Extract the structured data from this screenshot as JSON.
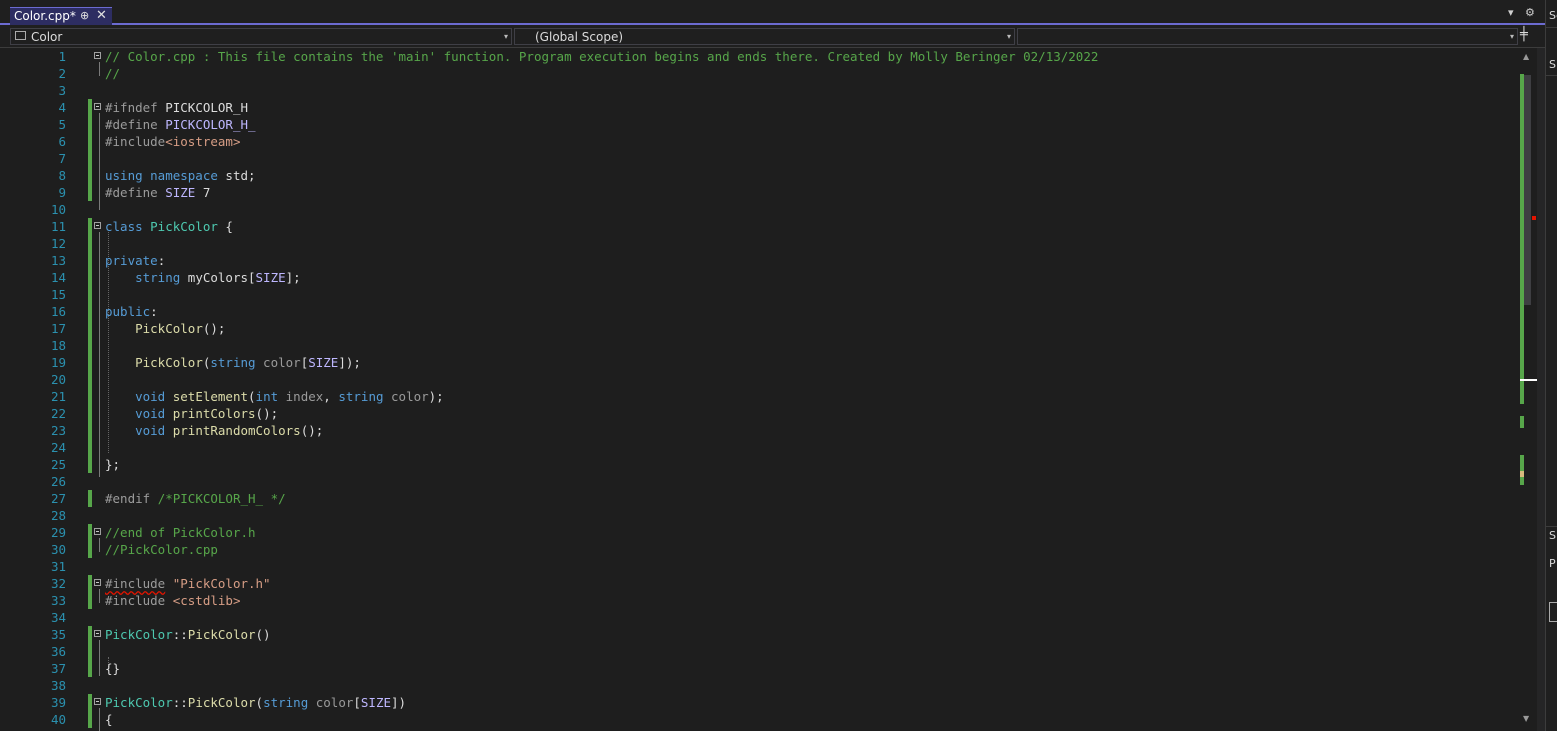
{
  "tab": {
    "title": "Color.cpp*",
    "pin_glyph": "⊕",
    "close_glyph": "✕"
  },
  "tabstrip_tools": {
    "dropdown_glyph": "▾",
    "gear_glyph": "⚙"
  },
  "navbar": {
    "project": "Color",
    "scope": "(Global Scope)",
    "member": "",
    "arrow": "▾",
    "split_glyph": "╪"
  },
  "right_panel": {
    "labels": [
      "Se",
      "S",
      "S",
      "P"
    ]
  },
  "colors": {
    "accent": "#6c6bd1",
    "comment": "#57a64a",
    "keyword": "#569cd6",
    "class": "#4ec9b0",
    "function": "#dcdcaa",
    "string": "#d69d85",
    "macro": "#beb7ff",
    "line_number": "#2b91af",
    "change_bar": "#57a64a"
  },
  "editor": {
    "lines": [
      {
        "n": "1",
        "fold": true,
        "chg": false,
        "t": [
          [
            "com",
            "// Color.cpp : This file contains the 'main' function. Program execution begins and ends there. Created by Molly Beringer 02/13/2022"
          ]
        ]
      },
      {
        "n": "2",
        "fold": false,
        "chg": false,
        "t": [
          [
            "com",
            "//"
          ]
        ]
      },
      {
        "n": "3",
        "fold": false,
        "chg": false,
        "t": []
      },
      {
        "n": "4",
        "fold": true,
        "chg": true,
        "t": [
          [
            "pre",
            "#ifndef "
          ],
          [
            "id",
            "PICKCOLOR_H"
          ]
        ]
      },
      {
        "n": "5",
        "fold": false,
        "chg": true,
        "t": [
          [
            "pre",
            "#define "
          ],
          [
            "mac",
            "PICKCOLOR_H_"
          ]
        ]
      },
      {
        "n": "6",
        "fold": false,
        "chg": true,
        "t": [
          [
            "pre",
            "#include"
          ],
          [
            "str",
            "<iostream>"
          ]
        ]
      },
      {
        "n": "7",
        "fold": false,
        "chg": true,
        "t": []
      },
      {
        "n": "8",
        "fold": false,
        "chg": true,
        "t": [
          [
            "kw",
            "using namespace "
          ],
          [
            "id",
            "std;"
          ]
        ]
      },
      {
        "n": "9",
        "fold": false,
        "chg": true,
        "t": [
          [
            "pre",
            "#define "
          ],
          [
            "mac",
            "SIZE"
          ],
          [
            "id",
            " 7"
          ]
        ]
      },
      {
        "n": "10",
        "fold": false,
        "chg": false,
        "t": []
      },
      {
        "n": "11",
        "fold": true,
        "chg": true,
        "t": [
          [
            "kw",
            "class "
          ],
          [
            "cls",
            "PickColor"
          ],
          [
            "id",
            " {"
          ]
        ]
      },
      {
        "n": "12",
        "fold": false,
        "chg": true,
        "t": []
      },
      {
        "n": "13",
        "fold": false,
        "chg": true,
        "t": [
          [
            "kw",
            "private"
          ],
          [
            "id",
            ":"
          ]
        ]
      },
      {
        "n": "14",
        "fold": false,
        "chg": true,
        "t": [
          [
            "id",
            "    "
          ],
          [
            "kw",
            "string"
          ],
          [
            "id",
            " myColors["
          ],
          [
            "mac",
            "SIZE"
          ],
          [
            "id",
            "];"
          ]
        ]
      },
      {
        "n": "15",
        "fold": false,
        "chg": true,
        "t": []
      },
      {
        "n": "16",
        "fold": false,
        "chg": true,
        "t": [
          [
            "kw",
            "public"
          ],
          [
            "id",
            ":"
          ]
        ]
      },
      {
        "n": "17",
        "fold": false,
        "chg": true,
        "t": [
          [
            "id",
            "    "
          ],
          [
            "fn",
            "PickColor"
          ],
          [
            "id",
            "();"
          ]
        ]
      },
      {
        "n": "18",
        "fold": false,
        "chg": true,
        "t": []
      },
      {
        "n": "19",
        "fold": false,
        "chg": true,
        "t": [
          [
            "id",
            "    "
          ],
          [
            "fn",
            "PickColor"
          ],
          [
            "id",
            "("
          ],
          [
            "kw",
            "string"
          ],
          [
            "par",
            " color"
          ],
          [
            "id",
            "["
          ],
          [
            "mac",
            "SIZE"
          ],
          [
            "id",
            "]);"
          ]
        ]
      },
      {
        "n": "20",
        "fold": false,
        "chg": true,
        "t": []
      },
      {
        "n": "21",
        "fold": false,
        "chg": true,
        "t": [
          [
            "id",
            "    "
          ],
          [
            "kw",
            "void "
          ],
          [
            "fn",
            "setElement"
          ],
          [
            "id",
            "("
          ],
          [
            "kw",
            "int"
          ],
          [
            "par",
            " index"
          ],
          [
            "id",
            ", "
          ],
          [
            "kw",
            "string"
          ],
          [
            "par",
            " color"
          ],
          [
            "id",
            ");"
          ]
        ]
      },
      {
        "n": "22",
        "fold": false,
        "chg": true,
        "t": [
          [
            "id",
            "    "
          ],
          [
            "kw",
            "void "
          ],
          [
            "fn",
            "printColors"
          ],
          [
            "id",
            "();"
          ]
        ]
      },
      {
        "n": "23",
        "fold": false,
        "chg": true,
        "t": [
          [
            "id",
            "    "
          ],
          [
            "kw",
            "void "
          ],
          [
            "fn",
            "printRandomColors"
          ],
          [
            "id",
            "();"
          ]
        ]
      },
      {
        "n": "24",
        "fold": false,
        "chg": true,
        "t": []
      },
      {
        "n": "25",
        "fold": false,
        "chg": true,
        "t": [
          [
            "id",
            "};"
          ]
        ]
      },
      {
        "n": "26",
        "fold": false,
        "chg": false,
        "t": []
      },
      {
        "n": "27",
        "fold": false,
        "chg": true,
        "t": [
          [
            "pre",
            "#endif "
          ],
          [
            "com",
            "/*PICKCOLOR_H_ */"
          ]
        ]
      },
      {
        "n": "28",
        "fold": false,
        "chg": false,
        "t": []
      },
      {
        "n": "29",
        "fold": true,
        "chg": true,
        "t": [
          [
            "com",
            "//end of PickColor.h"
          ]
        ]
      },
      {
        "n": "30",
        "fold": false,
        "chg": true,
        "t": [
          [
            "com",
            "//PickColor.cpp"
          ]
        ]
      },
      {
        "n": "31",
        "fold": false,
        "chg": false,
        "t": []
      },
      {
        "n": "32",
        "fold": true,
        "chg": true,
        "t": [
          [
            "pre_sq",
            "#include"
          ],
          [
            "str",
            " \"PickColor.h\""
          ]
        ]
      },
      {
        "n": "33",
        "fold": false,
        "chg": true,
        "t": [
          [
            "pre",
            "#include "
          ],
          [
            "str",
            "<cstdlib>"
          ]
        ]
      },
      {
        "n": "34",
        "fold": false,
        "chg": false,
        "t": []
      },
      {
        "n": "35",
        "fold": true,
        "chg": true,
        "t": [
          [
            "cls",
            "PickColor"
          ],
          [
            "id",
            "::"
          ],
          [
            "fn",
            "PickColor"
          ],
          [
            "id",
            "()"
          ]
        ]
      },
      {
        "n": "36",
        "fold": false,
        "chg": true,
        "t": []
      },
      {
        "n": "37",
        "fold": false,
        "chg": true,
        "t": [
          [
            "id",
            "{}"
          ]
        ]
      },
      {
        "n": "38",
        "fold": false,
        "chg": false,
        "t": []
      },
      {
        "n": "39",
        "fold": true,
        "chg": true,
        "t": [
          [
            "cls",
            "PickColor"
          ],
          [
            "id",
            "::"
          ],
          [
            "fn",
            "PickColor"
          ],
          [
            "id",
            "("
          ],
          [
            "kw",
            "string"
          ],
          [
            "par",
            " color"
          ],
          [
            "id",
            "["
          ],
          [
            "mac",
            "SIZE"
          ],
          [
            "id",
            "])"
          ]
        ]
      },
      {
        "n": "40",
        "fold": false,
        "chg": true,
        "t": [
          [
            "id",
            "{"
          ]
        ]
      }
    ]
  }
}
